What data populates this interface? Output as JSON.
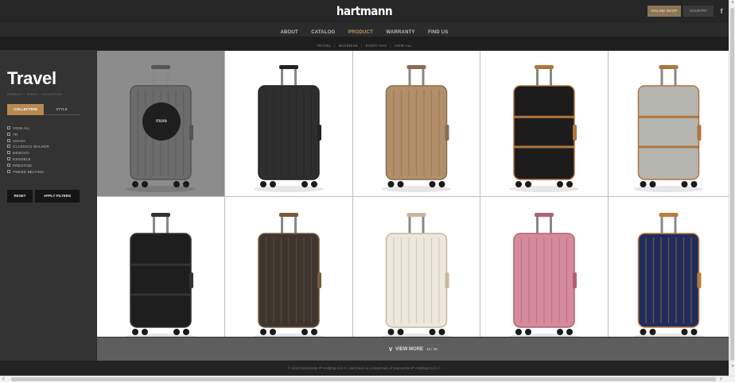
{
  "header": {
    "logo": "hartmann",
    "online_shop": "ONLINE SHOP",
    "country": "COUNTRY",
    "social_icon": "f"
  },
  "nav": {
    "items": [
      "ABOUT",
      "CATALOG",
      "PRODUCT",
      "WARRANTY",
      "FIND US"
    ],
    "active": "PRODUCT"
  },
  "subnav": {
    "items": [
      "TRAVEL",
      "BUSINESS",
      "EVERY DAY",
      "VIEW ALL"
    ]
  },
  "sidebar": {
    "title": "Travel",
    "breadcrumb": "PRODUCT > TRAVEL > COLLECTION",
    "tabs": [
      "COLLECTION",
      "STYLE"
    ],
    "filters": [
      "VIEW ALL",
      "7R",
      "ANASA",
      "CLASSICO WALKER",
      "DENOVO",
      "ESNOBLE",
      "PRESTIGE",
      "TWEED BELTING"
    ],
    "reset": "RESET",
    "apply": "APPLY FILTERS"
  },
  "grid": {
    "hover_label": "more",
    "products": [
      {
        "color": "#6c6c6c",
        "trim": "#555555",
        "style": "ribbed"
      },
      {
        "color": "#2e2e2e",
        "trim": "#222222",
        "style": "ribbed"
      },
      {
        "color": "#b08f6a",
        "trim": "#8a6d4e",
        "style": "ribbed"
      },
      {
        "color": "#1c1c1c",
        "trim": "#b0753f",
        "style": "banded"
      },
      {
        "color": "#b5b5b0",
        "trim": "#b0753f",
        "style": "banded"
      },
      {
        "color": "#1e1e1e",
        "trim": "#333333",
        "style": "banded"
      },
      {
        "color": "#3d3630",
        "trim": "#7a5a3a",
        "style": "ribbed"
      },
      {
        "color": "#ece8dc",
        "trim": "#c9b79a",
        "style": "ribbed"
      },
      {
        "color": "#d68aa0",
        "trim": "#b06070",
        "style": "ribbed"
      },
      {
        "color": "#1f2d5c",
        "trim": "#c07a3a",
        "style": "ribbed"
      }
    ]
  },
  "view_more": {
    "label": "VIEW MORE",
    "count": "10 / 46"
  },
  "footer": {
    "copyright": "© 2015 Samsonite IP Holdings S.à r.l. Hartmann is a trademark of Samsonite IP Holdings S.à r.l."
  }
}
